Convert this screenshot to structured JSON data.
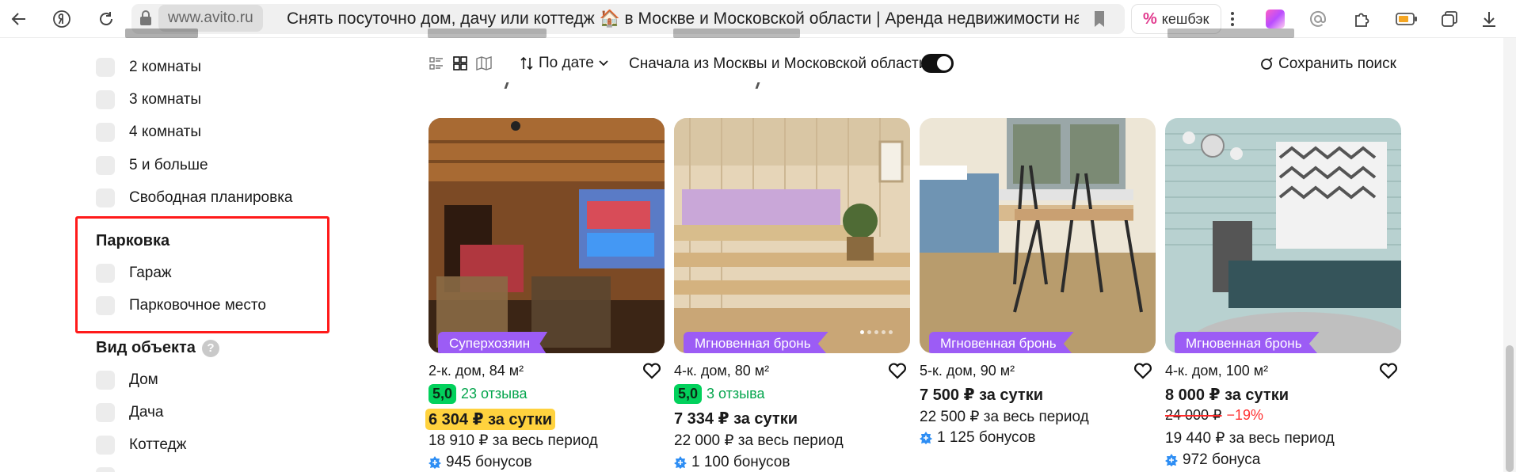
{
  "browser": {
    "domain": "www.avito.ru",
    "title": "Снять посуточно дом, дачу или коттедж 🏠 в Москве и Московской области | Аренда недвижимости на сутки на Авито",
    "cashback_label": "кешбэк",
    "icons": [
      "back-arrow-icon",
      "yandex-icon",
      "reload-icon",
      "lock-icon",
      "bookmark-icon",
      "more-icon",
      "extension-icons",
      "download-icon"
    ]
  },
  "sidebar": {
    "rooms": [
      "2 комнаты",
      "3 комнаты",
      "4 комнаты",
      "5 и больше",
      "Свободная планировка"
    ],
    "parking": {
      "title": "Парковка",
      "options": [
        "Гараж",
        "Парковочное место"
      ]
    },
    "object_type": {
      "title": "Вид объекта",
      "help": "?",
      "options": [
        "Дом",
        "Дача",
        "Коттедж"
      ]
    }
  },
  "toolbar": {
    "sort_label": "По дате",
    "moscow_first_label": "Сначала из Москвы и Московской области",
    "moscow_first_on": true,
    "save_search_label": "Сохранить поиск"
  },
  "listings": [
    {
      "badge": "Суперхозяин",
      "title": "2-к. дом, 84 м²",
      "rating": "5,0",
      "reviews": "23 отзыва",
      "price": "6 304 ₽ за сутки",
      "price_highlighted": true,
      "period_total": "18 910 ₽ за весь период",
      "bonus": "945 бонусов"
    },
    {
      "badge": "Мгновенная бронь",
      "title": "4-к. дом, 80 м²",
      "rating": "5,0",
      "reviews": "3 отзыва",
      "price": "7 334 ₽ за сутки",
      "price_highlighted": false,
      "period_total": "22 000 ₽ за весь период",
      "bonus": "1 100 бонусов"
    },
    {
      "badge": "Мгновенная бронь",
      "title": "5-к. дом, 90 м²",
      "price": "7 500 ₽ за сутки",
      "price_highlighted": false,
      "period_total": "22 500 ₽ за весь период",
      "bonus": "1 125 бонусов"
    },
    {
      "badge": "Мгновенная бронь",
      "title": "4-к. дом, 100 м²",
      "price": "8 000 ₽ за сутки",
      "price_highlighted": false,
      "old_price": "24 000 ₽",
      "discount": "−19%",
      "period_total": "19 440 ₽ за весь период",
      "bonus": "972 бонуса"
    }
  ],
  "colors": {
    "badge_purple": "#9c5cf5",
    "rating_green": "#02d15c",
    "price_highlight": "#ffd23e",
    "discount_red": "#ff3030",
    "annotation_red": "#ff1a1a"
  }
}
